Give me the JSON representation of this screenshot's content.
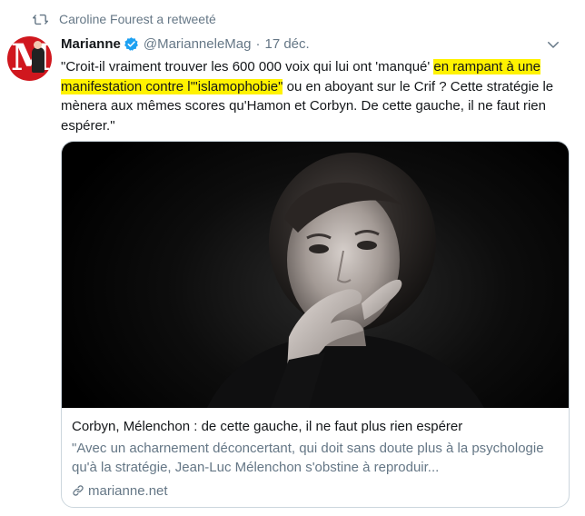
{
  "retweet": {
    "icon": "retweet-icon",
    "text": "Caroline Fourest a retweeté"
  },
  "author": {
    "avatar_letter": "M",
    "display_name": "Marianne",
    "verified_icon": "verified-badge-icon",
    "handle": "@MarianneleMag",
    "separator": "·",
    "date": "17 déc."
  },
  "tweet": {
    "text_before": "\"Croit-il vraiment trouver les 600 000 voix qui lui ont 'manqué' ",
    "text_highlighted": "en rampant à une manifestation contre l'\"islamophobie\"",
    "text_after": " ou en aboyant sur le Crif ? Cette stratégie le mènera aux mêmes scores qu'Hamon et Corbyn. De cette gauche, il ne faut rien espérer.\"",
    "highlight_color": "#fff200"
  },
  "card": {
    "image_icon": "portrait-photo",
    "title": "Corbyn, Mélenchon : de cette gauche, il ne faut plus rien espérer",
    "description": "\"Avec un acharnement déconcertant, qui doit sans doute plus à la psychologie qu'à la stratégie, Jean-Luc Mélenchon s'obstine à reproduir...",
    "link_icon": "link-icon",
    "domain": "marianne.net"
  },
  "colors": {
    "text_primary": "#14171a",
    "text_secondary": "#657786",
    "verified_blue": "#1da1f2",
    "brand_red": "#d0171e",
    "border": "#ccd6dd"
  }
}
